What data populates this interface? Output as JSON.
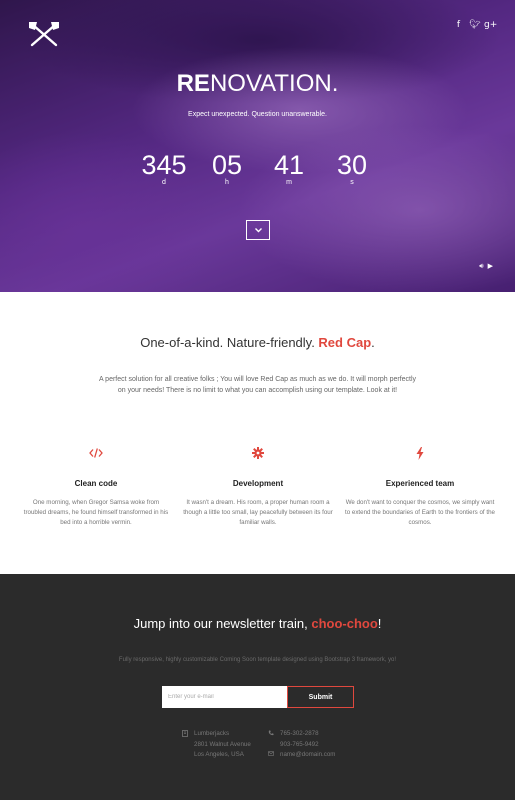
{
  "hero": {
    "brand_bold": "RE",
    "brand_rest": "NOVATION.",
    "tagline": "Expect unexpected. Question unanswerable.",
    "social": [
      "facebook-icon",
      "twitter-icon",
      "google-plus-icon"
    ],
    "countdown": [
      {
        "value": "345",
        "label": "d"
      },
      {
        "value": "05",
        "label": "h"
      },
      {
        "value": "41",
        "label": "m"
      },
      {
        "value": "30",
        "label": "s"
      }
    ]
  },
  "features": {
    "headline_prefix": "One-of-a-kind. Nature-friendly. ",
    "headline_accent": "Red Cap",
    "headline_suffix": ".",
    "intro": "A perfect solution for all creative folks ; You will love Red Cap as much as we do. It will morph perfectly on your needs! There is no limit to what you can accomplish using our template. Look at it!",
    "items": [
      {
        "icon": "code-icon",
        "title": "Clean code",
        "text": "One morning, when Gregor Samsa woke from troubled dreams, he found himself transformed in his bed into a horrible vermin."
      },
      {
        "icon": "gear-icon",
        "title": "Development",
        "text": "It wasn't a dream. His room, a proper human room a though a little too small, lay peacefully between its four familiar walls."
      },
      {
        "icon": "lightning-icon",
        "title": "Experienced team",
        "text": "We don't want to conquer the cosmos, we simply want to extend the boundaries of Earth to the frontiers of the cosmos."
      }
    ]
  },
  "newsletter": {
    "title_prefix": "Jump into our newsletter train, ",
    "title_accent": "choo-choo",
    "title_suffix": "!",
    "subtitle": "Fully responsive, highly customizable Coming Soon template designed using Bootstrap 3 framework, yo!",
    "email_placeholder": "Enter your e-mail",
    "submit_label": "Submit",
    "address": [
      "Lumberjacks",
      "2801 Walnut Avenue",
      "Los Angeles, USA"
    ],
    "phones": [
      "765-302-2878",
      "903-765-9492"
    ],
    "email": "name@domain.com"
  },
  "colors": {
    "accent": "#e0483e",
    "dark": "#2b2b2b"
  }
}
